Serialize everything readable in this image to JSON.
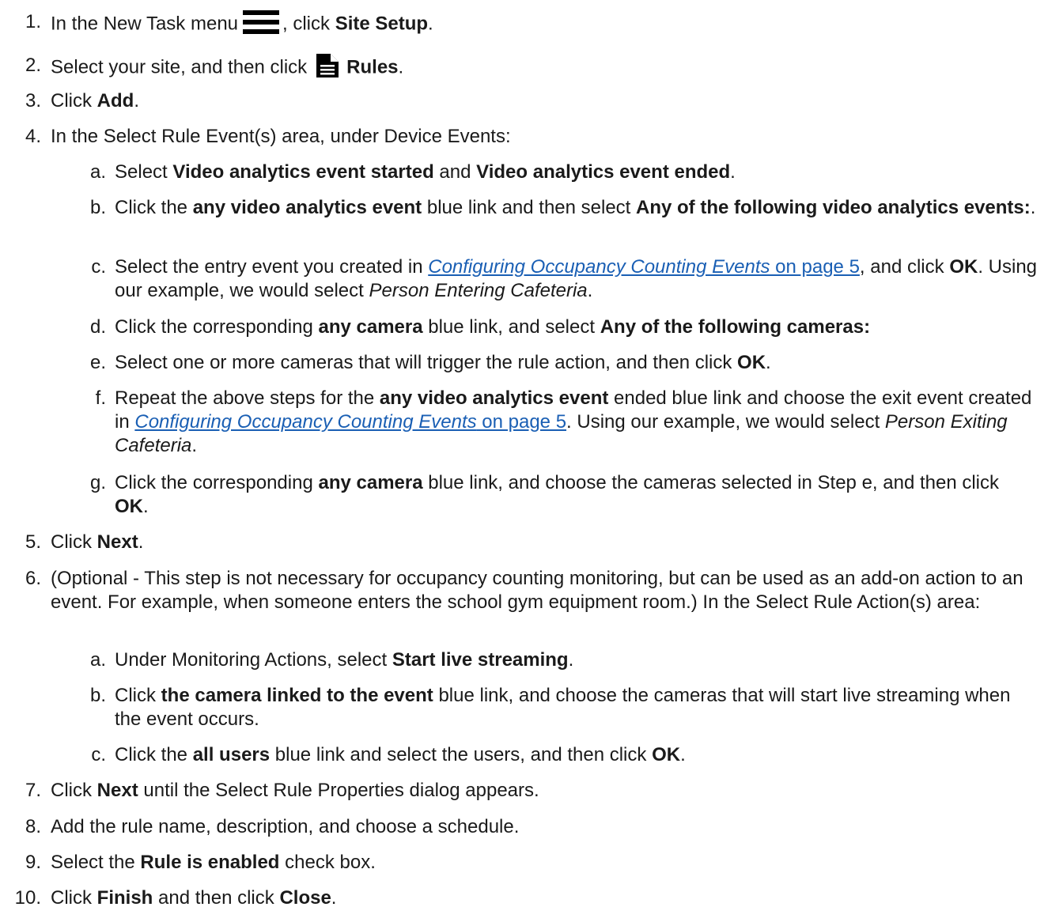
{
  "steps": [
    {
      "num": "1.",
      "before_icon": "In the New Task menu",
      "icon": "hamburger-menu-icon",
      "after_icon_1": ", click ",
      "b1": "Site Setup",
      "after_icon_2": "."
    },
    {
      "num": "2.",
      "before_icon": "Select your site, and then click",
      "icon": "document-icon",
      "b1": "Rules",
      "after": "."
    },
    {
      "num": "3.",
      "t1": "Click ",
      "b1": "Add",
      "t2": "."
    },
    {
      "num": "4.",
      "t1": "In the Select Rule Event(s) area, under Device Events:"
    },
    {
      "num": "5.",
      "t1": "Click ",
      "b1": "Next",
      "t2": "."
    },
    {
      "num": "6.",
      "t1": "(Optional - This step is not necessary for occupancy counting monitoring, but can be used as an add-on action to an event. For example, when someone enters the school gym equipment room.) In the Select Rule Action(s) area:"
    },
    {
      "num": "7.",
      "t1": "Click ",
      "b1": "Next",
      "t2": " until the Select Rule Properties dialog appears."
    },
    {
      "num": "8.",
      "t1": "Add the rule name, description, and choose a schedule."
    },
    {
      "num": "9.",
      "t1": "Select the ",
      "b1": "Rule is enabled",
      "t2": " check box."
    },
    {
      "num": "10.",
      "t1": "Click ",
      "b1": "Finish",
      "t2": " and then click ",
      "b2": "Close",
      "t3": "."
    }
  ],
  "step4_sub": [
    {
      "num": "a.",
      "t1": "Select ",
      "b1": "Video analytics event started",
      "t2": " and ",
      "b2": "Video analytics event ended",
      "t3": "."
    },
    {
      "num": "b.",
      "t1": "Click the ",
      "b1": "any video analytics event",
      "t2": " blue link and then select ",
      "b2": "Any of the following video analytics events:",
      "t3": "."
    },
    {
      "num": "c.",
      "t1": "Select the entry event you created in ",
      "link_title": "Configuring Occupancy Counting Events",
      "link_page": " on page 5",
      "t2": ", and click ",
      "b1": "OK",
      "t3": ". Using our example, we would select ",
      "i1": "Person Entering Cafeteria",
      "t4": "."
    },
    {
      "num": "d.",
      "t1": "Click the corresponding ",
      "b1": "any camera",
      "t2": " blue link, and select ",
      "b2": "Any of the following cameras:"
    },
    {
      "num": "e.",
      "t1": "Select one or more cameras that will trigger the rule action, and then click ",
      "b1": "OK",
      "t2": "."
    },
    {
      "num": "f.",
      "t1": "Repeat the above steps for the ",
      "b1": "any video analytics event",
      "t2": " ended blue link and choose the exit event created in ",
      "link_title": "Configuring Occupancy Counting Events",
      "link_page": " on page 5",
      "t3": ". Using our example, we would select ",
      "i1": "Person Exiting Cafeteria",
      "t4": "."
    },
    {
      "num": "g.",
      "t1": "Click the corresponding ",
      "b1": "any camera",
      "t2": " blue link, and choose the cameras selected in Step e, and then click ",
      "b2": "OK",
      "t3": "."
    }
  ],
  "step6_sub": [
    {
      "num": "a.",
      "t1": "Under Monitoring Actions, select ",
      "b1": "Start live streaming",
      "t2": "."
    },
    {
      "num": "b.",
      "t1": "Click ",
      "b1": "the camera linked to the event",
      "t2": " blue link, and choose the cameras that will start live streaming when the event occurs."
    },
    {
      "num": "c.",
      "t1": "Click the ",
      "b1": "all users",
      "t2": " blue link and select the users, and then click ",
      "b2": "OK",
      "t3": "."
    }
  ],
  "colors": {
    "text": "#1a1a1a",
    "link": "#1a5fb4"
  }
}
